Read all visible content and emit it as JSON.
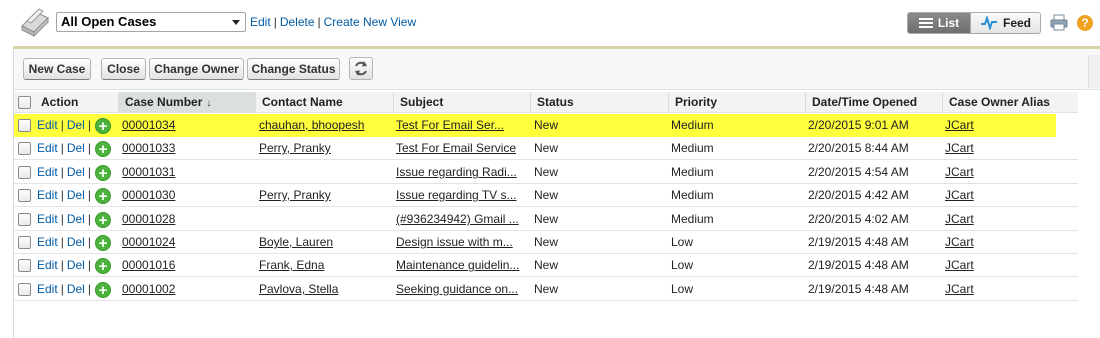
{
  "header": {
    "view_selected": "All Open Cases",
    "links": {
      "edit": "Edit",
      "delete": "Delete",
      "create_view": "Create New View"
    },
    "toggle": {
      "list": "List",
      "feed": "Feed"
    },
    "help": "?"
  },
  "toolbar": {
    "new_case": "New Case",
    "close": "Close",
    "change_owner": "Change Owner",
    "change_status": "Change Status"
  },
  "table": {
    "columns": [
      "Action",
      "Case Number",
      "Contact Name",
      "Subject",
      "Status",
      "Priority",
      "Date/Time Opened",
      "Case Owner Alias"
    ],
    "sort_indicator": "↓",
    "action_labels": {
      "edit": "Edit",
      "del": "Del"
    },
    "rows": [
      {
        "case": "00001034",
        "contact": "chauhan, bhoopesh",
        "subject": "Test For Email Ser...",
        "status": "New",
        "priority": "Medium",
        "opened": "2/20/2015 9:01 AM",
        "owner": "JCart"
      },
      {
        "case": "00001033",
        "contact": "Perry, Pranky",
        "subject": "Test For Email Service",
        "status": "New",
        "priority": "Medium",
        "opened": "2/20/2015 8:44 AM",
        "owner": "JCart"
      },
      {
        "case": "00001031",
        "contact": "",
        "subject": "Issue regarding Radi...",
        "status": "New",
        "priority": "Medium",
        "opened": "2/20/2015 4:54 AM",
        "owner": "JCart"
      },
      {
        "case": "00001030",
        "contact": "Perry, Pranky",
        "subject": "Issue regarding TV s...",
        "status": "New",
        "priority": "Medium",
        "opened": "2/20/2015 4:42 AM",
        "owner": "JCart"
      },
      {
        "case": "00001028",
        "contact": "",
        "subject": "(#936234942) Gmail ...",
        "status": "New",
        "priority": "Medium",
        "opened": "2/20/2015 4:02 AM",
        "owner": "JCart"
      },
      {
        "case": "00001024",
        "contact": "Boyle, Lauren",
        "subject": "Design issue with m...",
        "status": "New",
        "priority": "Low",
        "opened": "2/19/2015 4:48 AM",
        "owner": "JCart"
      },
      {
        "case": "00001016",
        "contact": "Frank, Edna",
        "subject": "Maintenance guidelin...",
        "status": "New",
        "priority": "Low",
        "opened": "2/19/2015 4:48 AM",
        "owner": "JCart"
      },
      {
        "case": "00001002",
        "contact": "Pavlova, Stella",
        "subject": "Seeking guidance on...",
        "status": "New",
        "priority": "Low",
        "opened": "2/19/2015 4:48 AM",
        "owner": "JCart"
      }
    ]
  },
  "colors": {
    "highlight_row": "#ffff3c",
    "link_blue": "#015ba7",
    "add_green": "#4bb33b",
    "help_orange": "#f0a21e"
  }
}
